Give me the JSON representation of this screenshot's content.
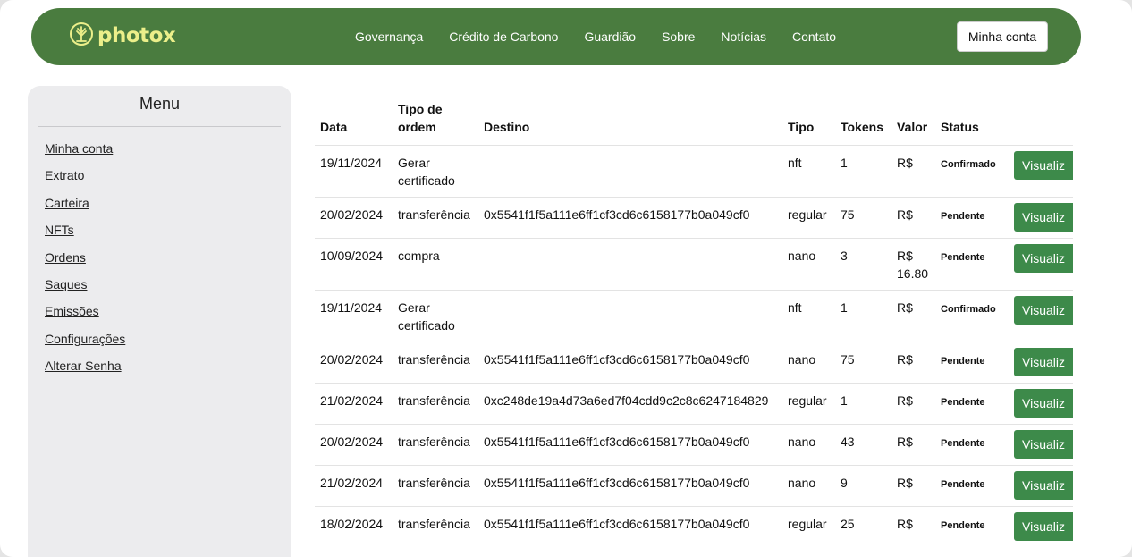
{
  "header": {
    "logo_text": "photox",
    "brand_color": "#4a7c3f",
    "logo_color": "#ecef8a",
    "nav": [
      "Governança",
      "Crédito de Carbono",
      "Guardião",
      "Sobre",
      "Notícias",
      "Contato"
    ],
    "account_button": "Minha conta"
  },
  "sidebar": {
    "title": "Menu",
    "items": [
      "Minha conta",
      "Extrato",
      "Carteira",
      "NFTs",
      "Ordens",
      "Saques",
      "Emissões",
      "Configurações",
      "Alterar Senha"
    ]
  },
  "orders": {
    "columns": {
      "date": "Data",
      "type_line1": "Tipo de",
      "type_line2": "ordem",
      "destination": "Destino",
      "kind": "Tipo",
      "tokens": "Tokens",
      "value": "Valor",
      "status": "Status"
    },
    "action_label": "Visualiz",
    "action_color": "#3d8a4a",
    "rows": [
      {
        "date": "19/11/2024",
        "type": "Gerar certificado",
        "destination": "",
        "kind": "nft",
        "tokens": "1",
        "value": "R$",
        "status": "Confirmado"
      },
      {
        "date": "20/02/2024",
        "type": "transferência",
        "destination": "0x5541f1f5a111e6ff1cf3cd6c6158177b0a049cf0",
        "kind": "regular",
        "tokens": "75",
        "value": "R$",
        "status": "Pendente"
      },
      {
        "date": "10/09/2024",
        "type": "compra",
        "destination": "",
        "kind": "nano",
        "tokens": "3",
        "value": "R$ 16.80",
        "status": "Pendente"
      },
      {
        "date": "19/11/2024",
        "type": "Gerar certificado",
        "destination": "",
        "kind": "nft",
        "tokens": "1",
        "value": "R$",
        "status": "Confirmado"
      },
      {
        "date": "20/02/2024",
        "type": "transferência",
        "destination": "0x5541f1f5a111e6ff1cf3cd6c6158177b0a049cf0",
        "kind": "nano",
        "tokens": "75",
        "value": "R$",
        "status": "Pendente"
      },
      {
        "date": "21/02/2024",
        "type": "transferência",
        "destination": "0xc248de19a4d73a6ed7f04cdd9c2c8c6247184829",
        "kind": "regular",
        "tokens": "1",
        "value": "R$",
        "status": "Pendente"
      },
      {
        "date": "20/02/2024",
        "type": "transferência",
        "destination": "0x5541f1f5a111e6ff1cf3cd6c6158177b0a049cf0",
        "kind": "nano",
        "tokens": "43",
        "value": "R$",
        "status": "Pendente"
      },
      {
        "date": "21/02/2024",
        "type": "transferência",
        "destination": "0x5541f1f5a111e6ff1cf3cd6c6158177b0a049cf0",
        "kind": "nano",
        "tokens": "9",
        "value": "R$",
        "status": "Pendente"
      },
      {
        "date": "18/02/2024",
        "type": "transferência",
        "destination": "0x5541f1f5a111e6ff1cf3cd6c6158177b0a049cf0",
        "kind": "regular",
        "tokens": "25",
        "value": "R$",
        "status": "Pendente"
      }
    ]
  }
}
